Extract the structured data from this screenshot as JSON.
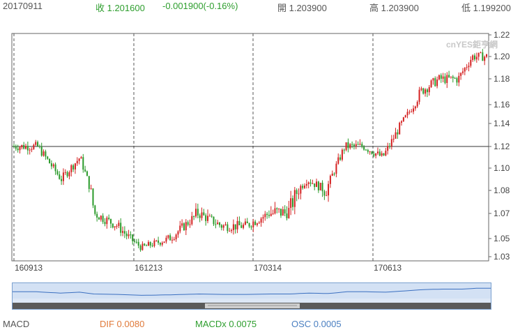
{
  "header": {
    "date": "20170911",
    "close_label": "收 1.201600",
    "change": "-0.001900(-0.16%)",
    "open_label": "開 1.203900",
    "high_label": "高 1.203900",
    "low_label": "低 1.199200"
  },
  "watermark": "cnYES鉅亨網",
  "chart_data": {
    "type": "candlestick",
    "x_tick_labels": [
      "160913",
      "161213",
      "170314",
      "170613"
    ],
    "y_tick_labels": [
      "1.22",
      "1.20",
      "1.18",
      "1.16",
      "1.14",
      "1.12",
      "1.10",
      "1.08",
      "1.07",
      "1.05",
      "1.03"
    ],
    "ylim": [
      1.03,
      1.22
    ],
    "reference_line": 1.12,
    "up_color": "#d42020",
    "down_color": "#2a9a2a",
    "approx_price_path": [
      {
        "x": 0,
        "y": 1.12
      },
      {
        "x": 0.05,
        "y": 1.12
      },
      {
        "x": 0.1,
        "y": 1.09
      },
      {
        "x": 0.14,
        "y": 1.11
      },
      {
        "x": 0.17,
        "y": 1.07
      },
      {
        "x": 0.22,
        "y": 1.06
      },
      {
        "x": 0.27,
        "y": 1.04
      },
      {
        "x": 0.33,
        "y": 1.05
      },
      {
        "x": 0.39,
        "y": 1.07
      },
      {
        "x": 0.44,
        "y": 1.06
      },
      {
        "x": 0.49,
        "y": 1.06
      },
      {
        "x": 0.54,
        "y": 1.07
      },
      {
        "x": 0.58,
        "y": 1.07
      },
      {
        "x": 0.62,
        "y": 1.09
      },
      {
        "x": 0.66,
        "y": 1.08
      },
      {
        "x": 0.7,
        "y": 1.12
      },
      {
        "x": 0.74,
        "y": 1.12
      },
      {
        "x": 0.78,
        "y": 1.11
      },
      {
        "x": 0.82,
        "y": 1.14
      },
      {
        "x": 0.86,
        "y": 1.17
      },
      {
        "x": 0.9,
        "y": 1.18
      },
      {
        "x": 0.94,
        "y": 1.18
      },
      {
        "x": 0.97,
        "y": 1.2
      },
      {
        "x": 1.0,
        "y": 1.2
      }
    ]
  },
  "footer": {
    "macd": "MACD",
    "dif": "DIF 0.0080",
    "macdx": "MACDx 0.0075",
    "osc": "OSC 0.0005"
  }
}
